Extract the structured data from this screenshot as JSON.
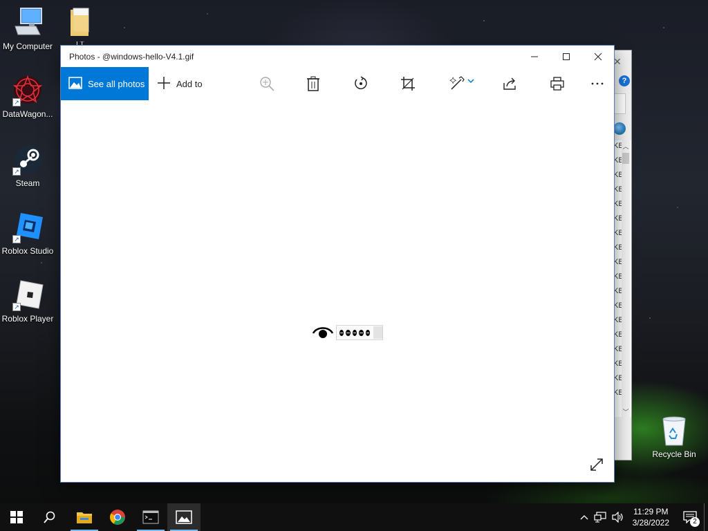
{
  "desktop": {
    "icons": [
      {
        "label": "My Computer",
        "icon": "computer-icon"
      },
      {
        "label": "DataWagon...",
        "icon": "datawagon-icon"
      },
      {
        "label": "Steam",
        "icon": "steam-icon"
      },
      {
        "label": "Roblox Studio",
        "icon": "roblox-studio-icon"
      },
      {
        "label": "Roblox Player",
        "icon": "roblox-player-icon"
      },
      {
        "label": "LT",
        "icon": "folder-icon"
      }
    ],
    "recycle_bin_label": "Recycle Bin"
  },
  "background_window": {
    "rows": [
      "KB",
      "KB",
      "KB",
      "KB",
      "KB",
      "KB",
      "KB",
      "KB",
      "KB",
      "KB",
      "KB",
      "KB",
      "KB",
      "KB",
      "KB",
      "KB",
      "KB",
      "KB"
    ]
  },
  "photos_window": {
    "title": "Photos - @windows-hello-V4.1.gif",
    "toolbar": {
      "see_all_label": "See all photos",
      "add_to_label": "Add to",
      "tools": [
        "zoom-icon",
        "delete-icon",
        "rotate-icon",
        "crop-icon",
        "edit-icon",
        "share-icon",
        "print-icon",
        "more-icon"
      ]
    }
  },
  "taskbar": {
    "apps": [
      "file-explorer-icon",
      "chrome-icon",
      "terminal-icon",
      "photos-icon"
    ],
    "active_app": "photos-icon",
    "time": "11:29 PM",
    "date": "3/28/2022",
    "notification_count": "2"
  },
  "colors": {
    "accent": "#0078d7",
    "taskbar": "#101010"
  }
}
